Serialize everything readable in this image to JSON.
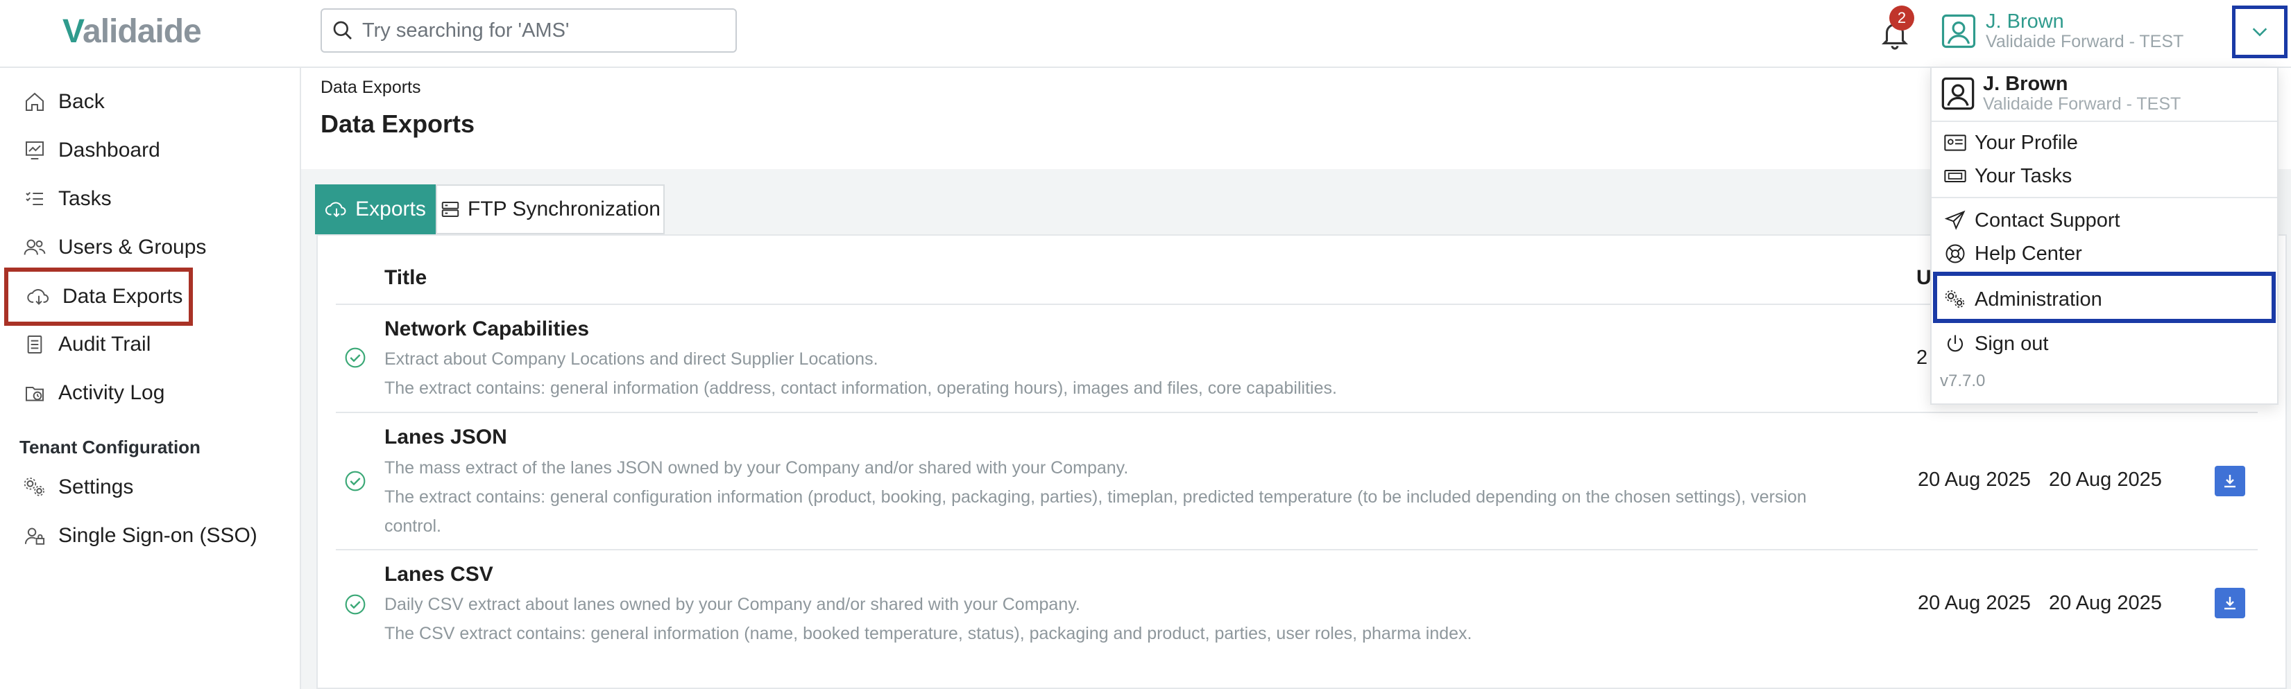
{
  "brand": {
    "logo": "Validaide",
    "accent": "#2f9b8d"
  },
  "search": {
    "placeholder": "Try searching for 'AMS'"
  },
  "notifications": {
    "count": "2"
  },
  "user": {
    "name": "J. Brown",
    "org": "Validaide Forward - TEST"
  },
  "sidebar": {
    "items": [
      {
        "label": "Back",
        "icon": "home-icon"
      },
      {
        "label": "Dashboard",
        "icon": "dashboard-icon"
      },
      {
        "label": "Tasks",
        "icon": "tasks-icon"
      },
      {
        "label": "Users & Groups",
        "icon": "users-icon"
      },
      {
        "label": "Data Exports",
        "icon": "cloud-download-icon"
      },
      {
        "label": "Audit Trail",
        "icon": "audit-icon"
      },
      {
        "label": "Activity Log",
        "icon": "activity-log-icon"
      }
    ],
    "section_title": "Tenant Configuration",
    "config_items": [
      {
        "label": "Settings",
        "icon": "settings-icon"
      },
      {
        "label": "Single Sign-on (SSO)",
        "icon": "sso-icon"
      }
    ]
  },
  "breadcrumb": "Data Exports",
  "page_title": "Data Exports",
  "tabs": [
    {
      "label": "Exports",
      "active": true
    },
    {
      "label": "FTP Synchronization",
      "active": false
    }
  ],
  "table": {
    "columns": {
      "title": "Title",
      "updated_partial": "U"
    },
    "rows": [
      {
        "title": "Network Capabilities",
        "desc1": "Extract about Company Locations and direct Supplier Locations.",
        "desc2": "The extract contains: general information (address, contact information, operating hours), images and files, core capabilities.",
        "date_partial": "2"
      },
      {
        "title": "Lanes JSON",
        "desc1": "The mass extract of the lanes JSON owned by your Company and/or shared with your Company.",
        "desc2": "The extract contains: general configuration information (product, booking, packaging, parties), timeplan, predicted temperature (to be included depending on the chosen settings), version",
        "desc3": "control.",
        "date1": "20 Aug 2025",
        "date2": "20 Aug 2025"
      },
      {
        "title": "Lanes CSV",
        "desc1": "Daily CSV extract about lanes owned by your Company and/or shared with your Company.",
        "desc2": "The CSV extract contains: general information (name, booked temperature, status), packaging and product, parties, user roles, pharma index.",
        "date1": "20 Aug 2025",
        "date2": "20 Aug 2025"
      }
    ]
  },
  "menu": {
    "user_name": "J. Brown",
    "user_org": "Validaide Forward - TEST",
    "items": [
      {
        "label": "Your Profile"
      },
      {
        "label": "Your Tasks"
      },
      {
        "label": "Contact Support"
      },
      {
        "label": "Help Center"
      },
      {
        "label": "Administration"
      },
      {
        "label": "Sign out"
      }
    ],
    "version": "v7.7.0"
  }
}
